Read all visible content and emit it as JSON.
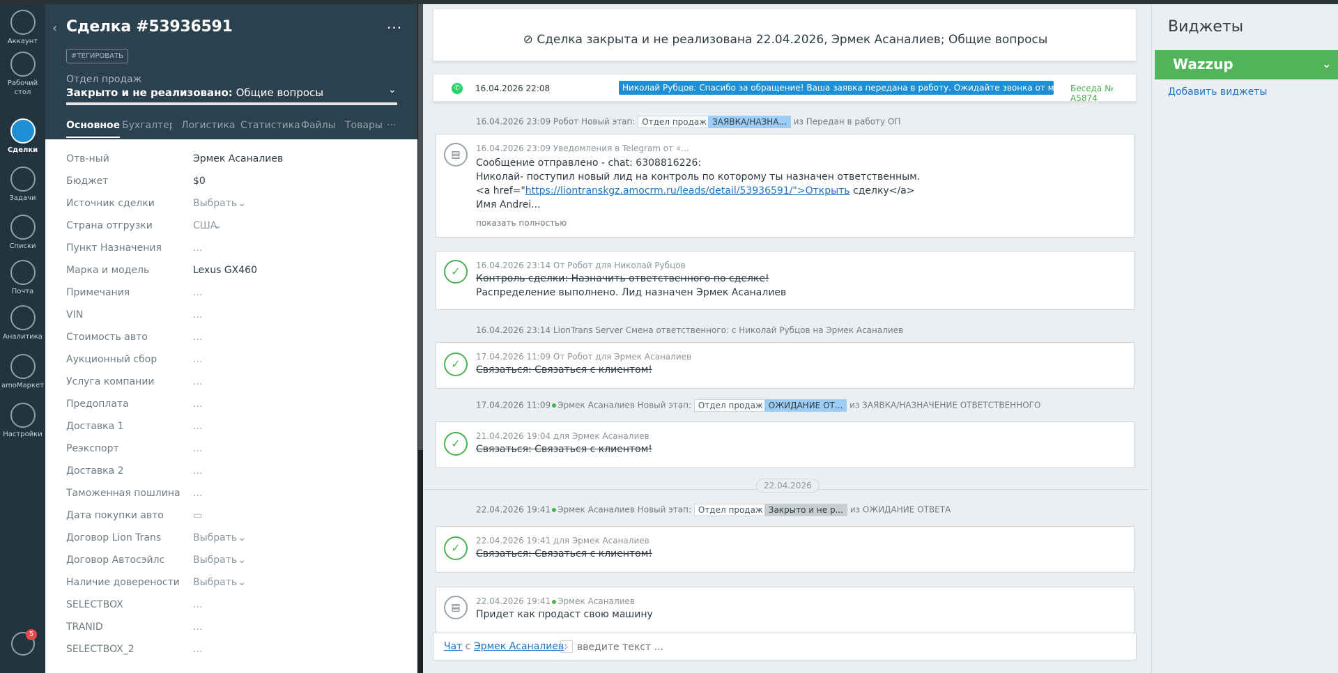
{
  "nav": {
    "items": [
      {
        "label": "Аккаунт",
        "icon": "avatar-icon"
      },
      {
        "label": "Рабочий стол",
        "icon": "dashboard-icon"
      },
      {
        "label": "Сделки",
        "icon": "deals-icon"
      },
      {
        "label": "Задачи",
        "icon": "tasks-icon"
      },
      {
        "label": "Списки",
        "icon": "lists-icon"
      },
      {
        "label": "Почта",
        "icon": "mail-icon"
      },
      {
        "label": "Аналитика",
        "icon": "analytics-icon"
      },
      {
        "label": "amoМаркет",
        "icon": "market-icon"
      },
      {
        "label": "Настройки",
        "icon": "settings-icon"
      }
    ],
    "notifications_count": "5"
  },
  "deal": {
    "title": "Сделка #53936591",
    "tag_button": "#ТЕГИРОВАТЬ",
    "pipeline": "Отдел продаж",
    "status_prefix": "Закрыто и не реализовано:",
    "status_reason": "Общие вопросы",
    "tabs": [
      "Основное",
      "Бухгалтер",
      "Логистика",
      "Статистика",
      "Файлы",
      "Товары"
    ],
    "tab_more": "···",
    "fields": [
      {
        "label": "Отв-ный",
        "value": "Эрмек Асаналиев",
        "kind": "value"
      },
      {
        "label": "Бюджет",
        "value": "$0",
        "kind": "value"
      },
      {
        "label": "Источник сделки",
        "value": "Выбрать",
        "kind": "select"
      },
      {
        "label": "Страна отгрузки",
        "value": "США",
        "kind": "select"
      },
      {
        "label": "Пункт Назначения",
        "value": "...",
        "kind": "empty"
      },
      {
        "label": "Марка и модель",
        "value": "Lexus GX460",
        "kind": "value"
      },
      {
        "label": "Примечания",
        "value": "...",
        "kind": "empty"
      },
      {
        "label": "VIN",
        "value": "...",
        "kind": "empty"
      },
      {
        "label": "Стоимость авто",
        "value": "...",
        "kind": "empty"
      },
      {
        "label": "Аукционный сбор",
        "value": "...",
        "kind": "empty"
      },
      {
        "label": "Услуга компании",
        "value": "...",
        "kind": "empty"
      },
      {
        "label": "Предоплата",
        "value": "...",
        "kind": "empty"
      },
      {
        "label": "Доставка 1",
        "value": "...",
        "kind": "empty"
      },
      {
        "label": "Реэкспорт",
        "value": "...",
        "kind": "empty"
      },
      {
        "label": "Доставка 2",
        "value": "...",
        "kind": "empty"
      },
      {
        "label": "Таможенная пошлина",
        "value": "...",
        "kind": "empty"
      },
      {
        "label": "Дата покупки авто",
        "value": "▭",
        "kind": "empty"
      },
      {
        "label": "Договор Lion Trans",
        "value": "Выбрать",
        "kind": "select"
      },
      {
        "label": "Договор Автосэйлс",
        "value": "Выбрать",
        "kind": "select"
      },
      {
        "label": "Наличие довереноcти",
        "value": "Выбрать",
        "kind": "select"
      },
      {
        "label": "SELECTBOX",
        "value": "...",
        "kind": "empty"
      },
      {
        "label": "TRANID",
        "value": "...",
        "kind": "empty"
      },
      {
        "label": "SELECTBOX_2",
        "value": "...",
        "kind": "empty"
      }
    ]
  },
  "feed": {
    "closed_banner": "Сделка закрыта и не реализована 22.04.2026, Эрмек Асаналиев; Общие вопросы",
    "whatsapp": {
      "date": "16.04.2026 22:08",
      "message": "Николай Рубцов: Спасибо за обращение! Ваша заявка передана в работу. Ожидайте звонка от менеджер...",
      "conversation": "Беседа № A5874"
    },
    "stage_change_1": {
      "meta": "16.04.2026 23:09 Робот Новый этап:",
      "pipeline": "Отдел продаж",
      "stage": "ЗАЯВКА/НАЗНА...",
      "from": "из Передан в работу ОП"
    },
    "telegram_note": {
      "meta": "16.04.2026 23:09 Уведомления в Telegram от «...",
      "line1": "Сообщение отправлено - chat: 6308816226:",
      "line2": "Николай- поступил новый лид на контроль по которому ты назначен ответственным.",
      "line3_pre": "<a href=\"",
      "line3_link": "https://liontranskgz.amocrm.ru/leads/detail/53936591/\">Открыть",
      "line3_post": " сделку</a>",
      "line4": "Имя Andrei...",
      "show_more": "показать полностью"
    },
    "task1": {
      "meta": "16.04.2026 23:14  От Робот для Николай Рубцов",
      "line1": "Контроль сделки: Назначить ответственного по сделке!",
      "line2": "Распределение выполнено. Лид назначен Эрмек Асаналиев"
    },
    "resp_change": "16.04.2026 23:14 LionTrans Server Смена ответственного: с Николай Рубцов на Эрмек Асаналиев",
    "task2": {
      "meta": "17.04.2026 11:09  От Робот для Эрмек Асаналиев",
      "line1": "Связаться: Связаться с клиентом!"
    },
    "stage_change_2": {
      "meta_pre": "17.04.2026 11:09",
      "meta_post": "Эрмек Асаналиев Новый этап:",
      "pipeline": "Отдел продаж",
      "stage": "ОЖИДАНИЕ ОТ...",
      "from": "из ЗАЯВКА/НАЗНАЧЕНИЕ ОТВЕТСТВЕННОГО"
    },
    "task3": {
      "meta": "21.04.2026 19:04  для Эрмек Асаналиев",
      "line1": "Связаться: Связаться с клиентом!"
    },
    "date_separator": "22.04.2026",
    "stage_change_3": {
      "meta_pre": "22.04.2026 19:41",
      "meta_post": "Эрмек Асаналиев Новый этап:",
      "pipeline": "Отдел продаж",
      "stage": "Закрыто и не р...",
      "from": "из ОЖИДАНИЕ ОТВЕТА"
    },
    "task4": {
      "meta": "22.04.2026 19:41  для Эрмек Асаналиев",
      "line1": "Связаться: Связаться с клиентом!"
    },
    "note_last": {
      "meta_pre": "22.04.2026 19:41",
      "meta_post": "Эрмек Асаналиев",
      "line1": "Придет как продаст свою машину"
    },
    "chat": {
      "chat_label": "Чат",
      "with": "с",
      "contact": "Эрмек Асаналиев",
      "colon": ":",
      "placeholder": "введите текст ..."
    }
  },
  "widgets": {
    "title": "Виджеты",
    "wazzup": "Wazzup",
    "add": "Добавить виджеты"
  },
  "colors": {
    "nav_bg": "#21343f",
    "deal_header_bg": "#2c414e",
    "accent_blue": "#1e8fd4",
    "success_green": "#4caf50",
    "wazzup_green": "#52b35a"
  }
}
